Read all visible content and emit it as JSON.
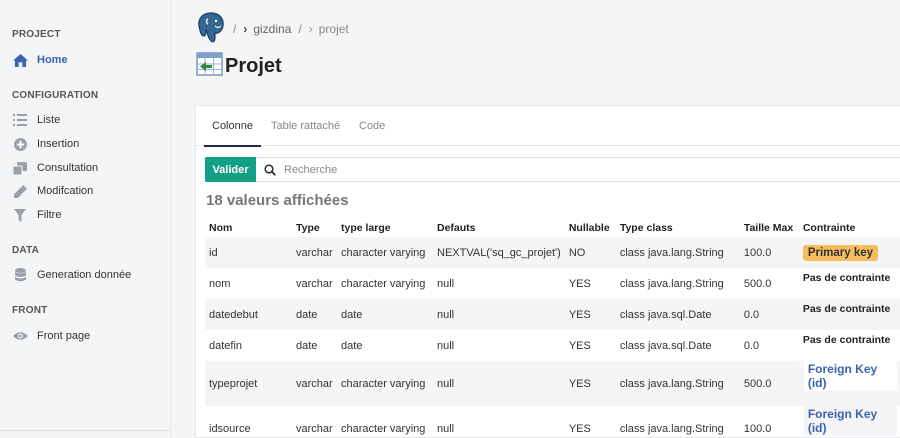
{
  "sidebar": {
    "sections": {
      "project": "PROJECT",
      "configuration": "CONFIGURATION",
      "data": "DATA",
      "front": "FRONT"
    },
    "items": [
      {
        "label": "Home",
        "icon": "home-icon",
        "active": true
      },
      {
        "label": "Liste",
        "icon": "list-icon"
      },
      {
        "label": "Insertion",
        "icon": "plus-circle-icon"
      },
      {
        "label": "Consultation",
        "icon": "clone-icon"
      },
      {
        "label": "Modifcation",
        "icon": "pencil-icon"
      },
      {
        "label": "Filtre",
        "icon": "filter-icon"
      },
      {
        "label": "Generation donnée",
        "icon": "database-icon"
      },
      {
        "label": "Front page",
        "icon": "eye-icon"
      }
    ]
  },
  "breadcrumb": {
    "db": "gizdina",
    "current": "projet"
  },
  "page_title": "Projet",
  "tabs": [
    "Colonne",
    "Table rattaché",
    "Code"
  ],
  "search": {
    "button": "Valider",
    "placeholder": "Recherche"
  },
  "count_label": "18 valeurs affichées",
  "table": {
    "headers": [
      "Nom",
      "Type",
      "type large",
      "Defauts",
      "Nullable",
      "Type class",
      "Taille Max",
      "Contrainte"
    ],
    "rows": [
      {
        "nom": "id",
        "type": "varchar",
        "type_large": "character varying",
        "defauts": "NEXTVAL('sq_gc_projet')",
        "nullable": "NO",
        "type_class": "class java.lang.String",
        "taille_max": "100.0",
        "contrainte": "Primary key"
      },
      {
        "nom": "nom",
        "type": "varchar",
        "type_large": "character varying",
        "defauts": "null",
        "nullable": "YES",
        "type_class": "class java.lang.String",
        "taille_max": "500.0",
        "contrainte": "Pas de contrainte"
      },
      {
        "nom": "datedebut",
        "type": "date",
        "type_large": "date",
        "defauts": "null",
        "nullable": "YES",
        "type_class": "class java.sql.Date",
        "taille_max": "0.0",
        "contrainte": "Pas de contrainte"
      },
      {
        "nom": "datefin",
        "type": "date",
        "type_large": "date",
        "defauts": "null",
        "nullable": "YES",
        "type_class": "class java.sql.Date",
        "taille_max": "0.0",
        "contrainte": "Pas de contrainte"
      },
      {
        "nom": "typeprojet",
        "type": "varchar",
        "type_large": "character varying",
        "defauts": "null",
        "nullable": "YES",
        "type_class": "class java.lang.String",
        "taille_max": "500.0",
        "contrainte": "Foreign Key (id)"
      },
      {
        "nom": "idsource",
        "type": "varchar",
        "type_large": "character varying",
        "defauts": "null",
        "nullable": "YES",
        "type_class": "class java.lang.String",
        "taille_max": "100.0",
        "contrainte": "Foreign Key (id)"
      }
    ]
  },
  "colors": {
    "accent": "#13a086",
    "link": "#3a62b0",
    "primary_key_badge": "#f6bd5d",
    "tab_underline": "#1c2f4a"
  }
}
